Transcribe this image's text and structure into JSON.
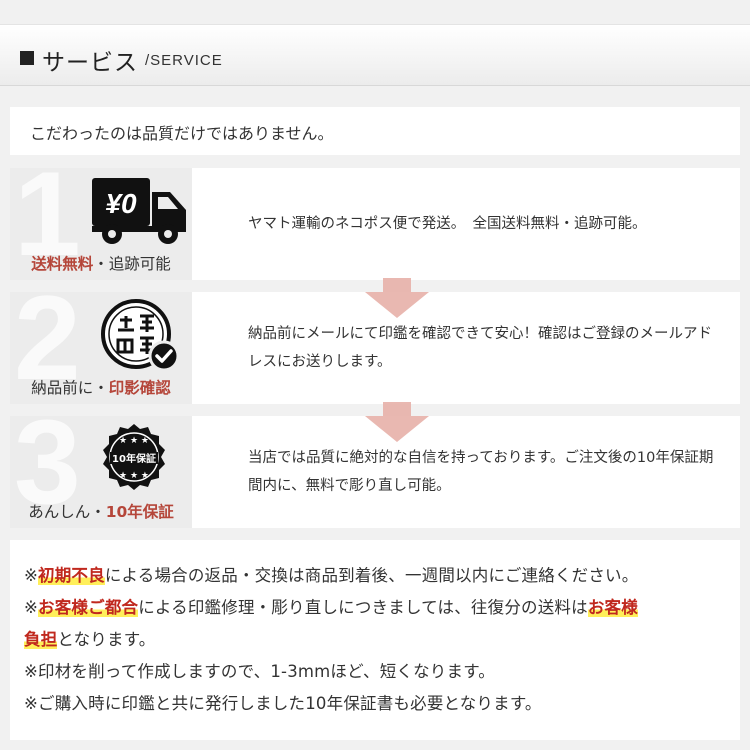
{
  "header": {
    "title": "サービス",
    "subtitle": "/SERVICE"
  },
  "intro": "こだわったのは品質だけではありません。",
  "steps": [
    {
      "number": "1",
      "icon": "truck-yen-icon",
      "icon_text": "¥0",
      "caption_highlight": "送料無料",
      "caption_rest": "・追跡可能",
      "text": "ヤマト運輸のネコポス便で発送。　全国送料無料・追跡可能。"
    },
    {
      "number": "2",
      "icon": "seal-check-icon",
      "caption_plain": "納品前に・",
      "caption_highlight": "印影確認",
      "text": "納品前にメールにて印鑑を確認できて安心！確認はご登録のメールアドレスにお送りします。"
    },
    {
      "number": "3",
      "icon": "warranty-badge-icon",
      "icon_text": "10年保証",
      "caption_plain": "あんしん・",
      "caption_highlight": "10年保証",
      "text": "当店では品質に絶対的な自信を持っております。ご注文後の10年保証期間内に、無料で彫り直し可能。"
    }
  ],
  "notes": {
    "l1_pre": "※",
    "l1_hl": "初期不良",
    "l1_post": "による場合の返品・交換は商品到着後、一週間以内にご連絡ください。",
    "l2_pre": "※",
    "l2_hl": "お客様ご都合",
    "l2_mid": "による印鑑修理・彫り直しにつきましては、往復分の送料は",
    "l2_hl2": "お客様",
    "l3_hl": "負担",
    "l3_post": "となります。",
    "l4": "※印材を削って作成しますので、1-3mmほど、短くなります。",
    "l5": "※ご購入時に印鑑と共に発行しました10年保証書も必要となります。"
  },
  "colors": {
    "accent_red": "#b5463a",
    "note_red": "#c0281e",
    "highlight": "#ffef5a",
    "arrow": "#e7b0a8"
  }
}
